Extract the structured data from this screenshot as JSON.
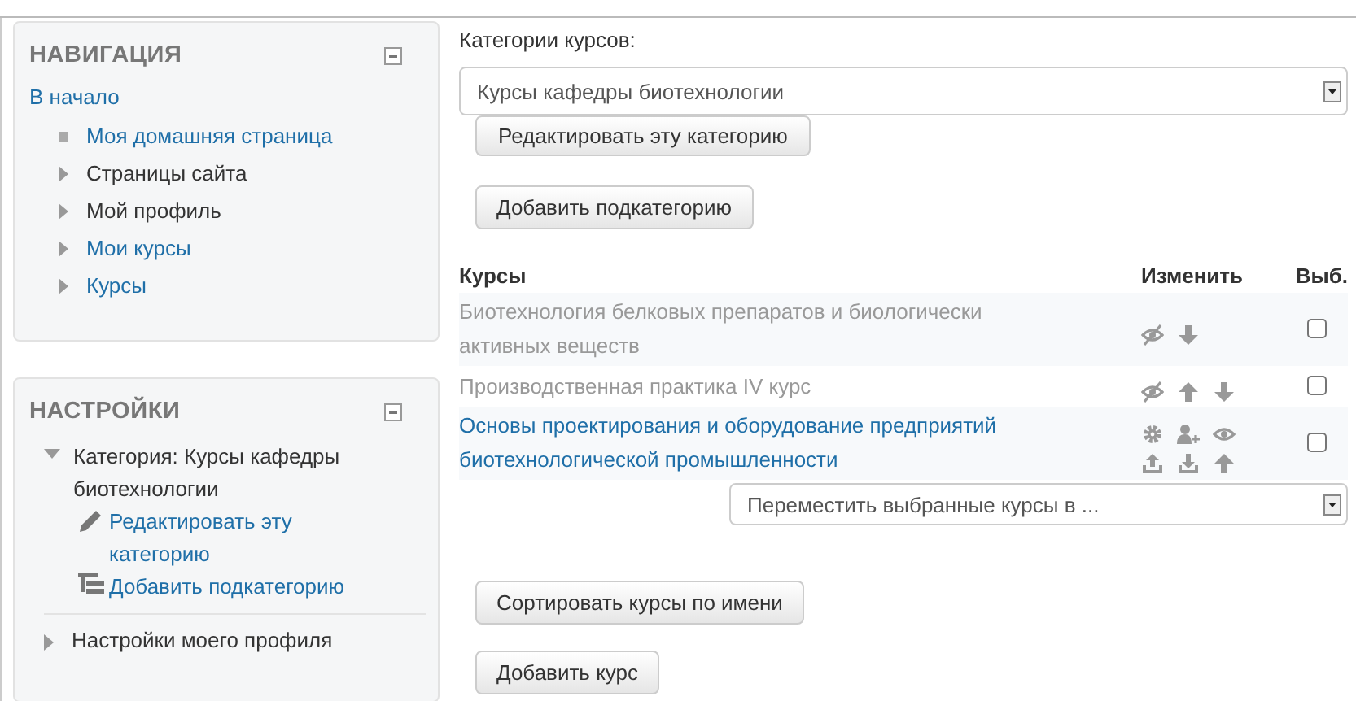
{
  "navigation": {
    "title": "НАВИГАЦИЯ",
    "home": "В начало",
    "items": [
      {
        "label": "Моя домашняя страница",
        "kind": "leaf",
        "link": true
      },
      {
        "label": "Страницы сайта",
        "kind": "branch",
        "link": false
      },
      {
        "label": "Мой профиль",
        "kind": "branch",
        "link": false
      },
      {
        "label": "Мои курсы",
        "kind": "branch",
        "link": true
      },
      {
        "label": "Курсы",
        "kind": "branch",
        "link": true
      }
    ]
  },
  "settings": {
    "title": "НАСТРОЙКИ",
    "items": [
      {
        "label": "Категория: Курсы кафедры биотехнологии",
        "expanded": true,
        "children": [
          {
            "label": "Редактировать эту категорию",
            "kind": "edit"
          },
          {
            "label": "Добавить подкатегорию",
            "kind": "add"
          }
        ]
      },
      {
        "label": "Настройки моего профиля",
        "expanded": false
      }
    ]
  },
  "category_label": "Категории курсов:",
  "category_select": "Курсы кафедры биотехнологии",
  "category_buttons": [
    "Редактировать эту категорию",
    "Добавить подкатегорию"
  ],
  "table": {
    "columns": [
      "Курсы",
      "Изменить",
      "Выб."
    ],
    "rows": [
      {
        "name": "Биотехнология белковых препаратов и биологически активных веществ",
        "hidden": true,
        "actions": [
          {
            "kind": "hide"
          },
          {
            "kind": "down"
          }
        ],
        "checked": false
      },
      {
        "name": "Производственная практика IV курс",
        "hidden": true,
        "actions": [
          {
            "kind": "hide"
          },
          {
            "kind": "up"
          },
          {
            "kind": "down"
          }
        ],
        "checked": false
      },
      {
        "name": "Основы проектирования и оборудование предприятий биотехнологической промышленности",
        "hidden": false,
        "actions": [
          {
            "kind": "gear"
          },
          {
            "kind": "enrol"
          },
          {
            "kind": "show"
          },
          {
            "kind": "upload"
          },
          {
            "kind": "download"
          },
          {
            "kind": "up"
          }
        ],
        "checked": false
      }
    ]
  },
  "move_select": "Переместить выбранные курсы в ...",
  "bottom_buttons": [
    "Сортировать курсы по имени",
    "Добавить курс"
  ]
}
